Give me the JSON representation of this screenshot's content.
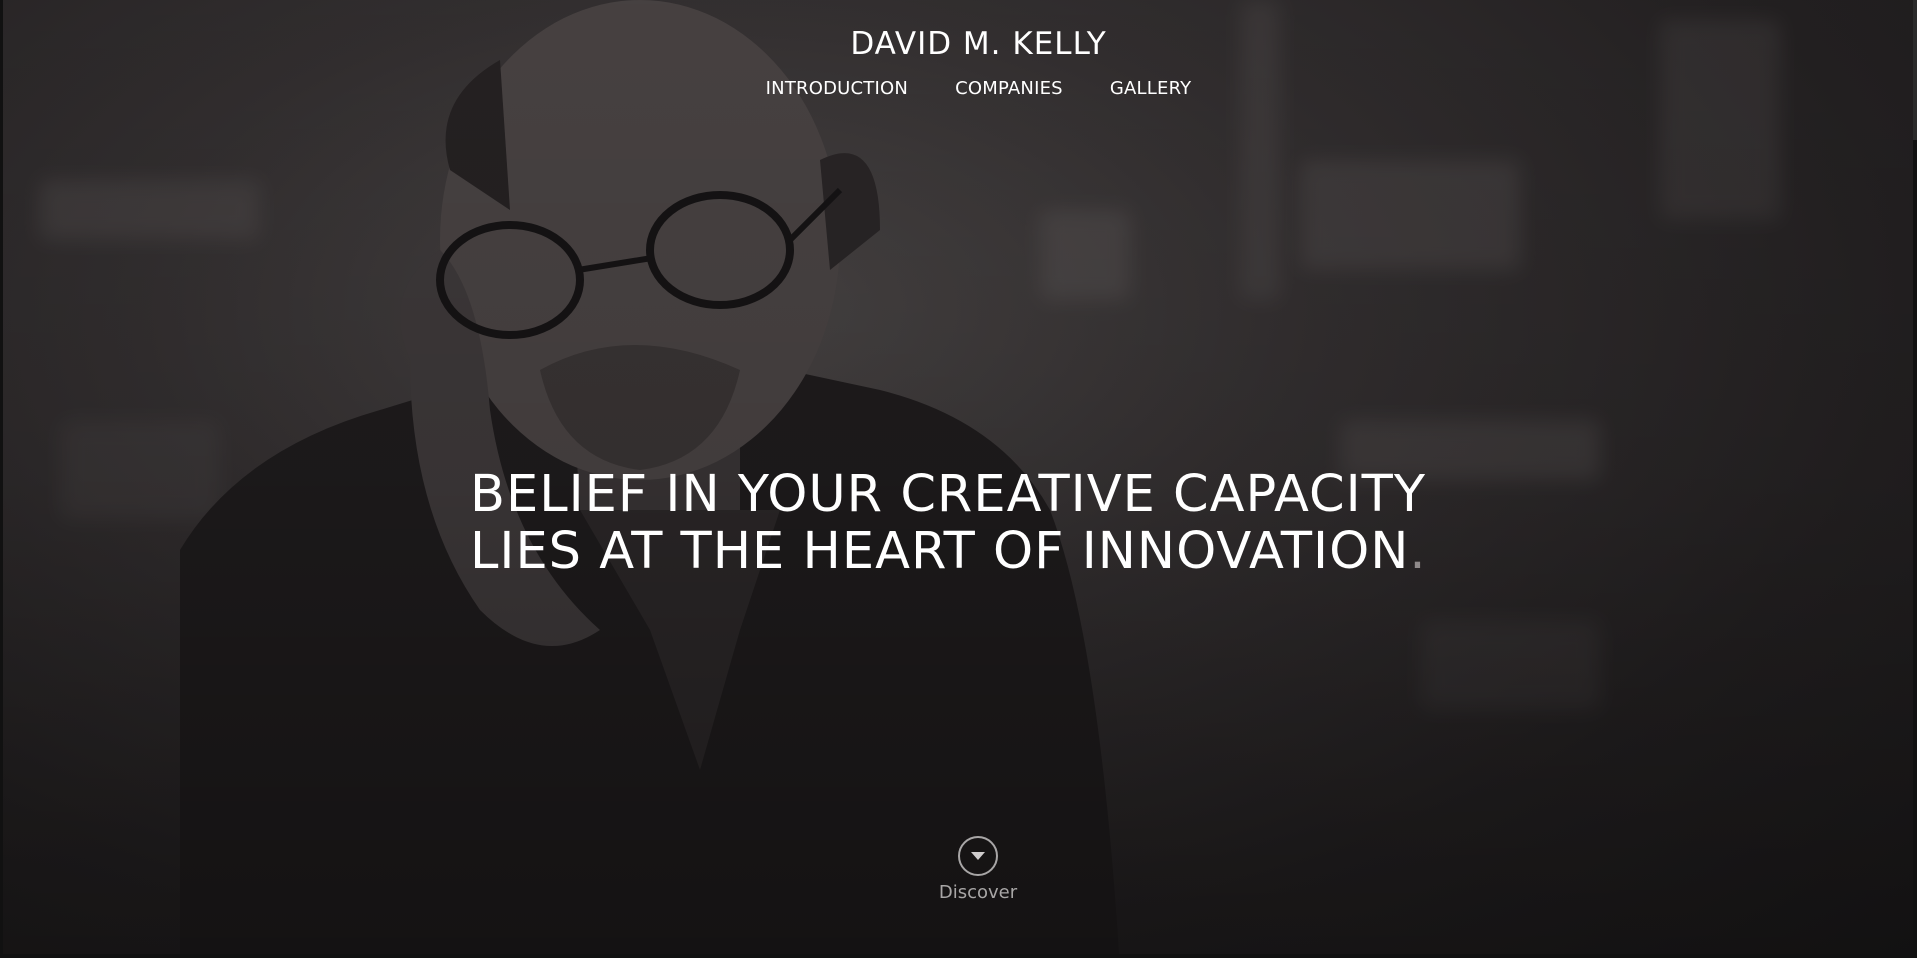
{
  "header": {
    "site_title": "DAVID M. KELLY"
  },
  "nav": {
    "items": [
      {
        "label": "INTRODUCTION"
      },
      {
        "label": "COMPANIES"
      },
      {
        "label": "GALLERY"
      }
    ]
  },
  "hero": {
    "headline_line1": "BELIEF IN YOUR CREATIVE CAPACITY",
    "headline_line2": "LIES AT THE HEART OF INNOVATION",
    "headline_period": ".",
    "discover_label": "Discover"
  },
  "colors": {
    "text": "#ffffff",
    "muted": "#a8a6a6",
    "accent_dot": "#8f8a8a"
  },
  "icons": {
    "discover": "chevron-down-circle-icon"
  }
}
